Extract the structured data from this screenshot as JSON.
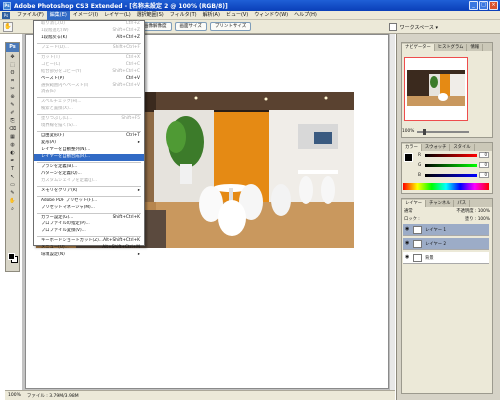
{
  "window": {
    "title": "Adobe Photoshop CS3 Extended - [名称未設定 2 @ 100% (RGB/8)]",
    "app_icon": "Ps",
    "minimize": "_",
    "maximize": "□",
    "close": "×"
  },
  "menubar": {
    "icon": "Ps",
    "items": [
      "ファイル(F)",
      "編集(E)",
      "イメージ(I)",
      "レイヤー(L)",
      "選択範囲(S)",
      "フィルタ(T)",
      "解析(A)",
      "ビュー(V)",
      "ウィンドウ(W)",
      "ヘルプ(H)"
    ]
  },
  "options_bar": {
    "tool_icon": "✋",
    "buttons": [
      "画像解像度",
      "画面サイズ",
      "プリントサイズ"
    ],
    "workspace_label": "ワークスペース ▾"
  },
  "edit_menu": {
    "items": [
      {
        "label": "取り消し(O)",
        "shortcut": "Ctrl+Z",
        "state": "disabled"
      },
      {
        "label": "1段階進む(W)",
        "shortcut": "Shift+Ctrl+Z",
        "state": "disabled"
      },
      {
        "label": "1段階戻る(K)",
        "shortcut": "Alt+Ctrl+Z",
        "state": "normal"
      },
      {
        "sep": true
      },
      {
        "label": "フェード(D)...",
        "shortcut": "Shift+Ctrl+F",
        "state": "disabled"
      },
      {
        "sep": true
      },
      {
        "label": "カット(T)",
        "shortcut": "Ctrl+X",
        "state": "disabled"
      },
      {
        "label": "コピー(C)",
        "shortcut": "Ctrl+C",
        "state": "disabled"
      },
      {
        "label": "結合部分をコピー(Y)",
        "shortcut": "Shift+Ctrl+C",
        "state": "disabled"
      },
      {
        "label": "ペースト(P)",
        "shortcut": "Ctrl+V",
        "state": "normal"
      },
      {
        "label": "選択範囲内へペースト(I)",
        "shortcut": "Shift+Ctrl+V",
        "state": "disabled"
      },
      {
        "label": "消去(E)",
        "shortcut": "",
        "state": "disabled"
      },
      {
        "sep": true
      },
      {
        "label": "スペルチェック(H)...",
        "shortcut": "",
        "state": "disabled"
      },
      {
        "label": "検索と置換(X)...",
        "shortcut": "",
        "state": "disabled"
      },
      {
        "sep": true
      },
      {
        "label": "塗りつぶし(L)...",
        "shortcut": "Shift+F5",
        "state": "disabled"
      },
      {
        "label": "境界線を描く(S)...",
        "shortcut": "",
        "state": "disabled"
      },
      {
        "sep": true
      },
      {
        "label": "自由変形(F)",
        "shortcut": "Ctrl+T",
        "state": "normal"
      },
      {
        "label": "変形(A)",
        "shortcut": "▸",
        "state": "normal"
      },
      {
        "label": "レイヤーを自動整列(N)...",
        "shortcut": "",
        "state": "normal"
      },
      {
        "label": "レイヤーを自動合成(R)...",
        "shortcut": "",
        "state": "highlight"
      },
      {
        "sep": true
      },
      {
        "label": "ブラシを定義(B)...",
        "shortcut": "",
        "state": "normal"
      },
      {
        "label": "パターンを定義(Q)...",
        "shortcut": "",
        "state": "normal"
      },
      {
        "label": "カスタムシェイプを定義(J)...",
        "shortcut": "",
        "state": "disabled"
      },
      {
        "sep": true
      },
      {
        "label": "メモリをクリア(R)",
        "shortcut": "▸",
        "state": "normal"
      },
      {
        "sep": true
      },
      {
        "label": "Adobe PDF プリセット(F)...",
        "shortcut": "",
        "state": "normal"
      },
      {
        "label": "プリセットマネージャ(M)...",
        "shortcut": "",
        "state": "normal"
      },
      {
        "sep": true
      },
      {
        "label": "カラー設定(G)...",
        "shortcut": "Shift+Ctrl+K",
        "state": "normal"
      },
      {
        "label": "プロファイルの指定(P)...",
        "shortcut": "",
        "state": "normal"
      },
      {
        "label": "プロファイル変換(V)...",
        "shortcut": "",
        "state": "normal"
      },
      {
        "sep": true
      },
      {
        "label": "キーボードショートカット(Z)...",
        "shortcut": "Alt+Shift+Ctrl+K",
        "state": "normal"
      },
      {
        "label": "メニュー(U)...",
        "shortcut": "Alt+Shift+Ctrl+M",
        "state": "normal"
      },
      {
        "label": "環境設定(N)",
        "shortcut": "▸",
        "state": "normal"
      }
    ]
  },
  "toolbox": {
    "logo": "Ps",
    "tools": [
      "✥",
      "⬚",
      "ʘ",
      "⌗",
      "✂",
      "⊕",
      "✎",
      "✐",
      "⎘",
      "⌫",
      "▦",
      "◍",
      "◐",
      "✒",
      "T",
      "↖",
      "▭",
      "✎",
      "✋",
      "⌕"
    ]
  },
  "status_bar": {
    "zoom": "100%",
    "file_info": "ファイル : 3.79M/3.98M"
  },
  "navigator_panel": {
    "tabs": [
      "ナビゲーター",
      "ヒストグラム",
      "情報"
    ],
    "zoom_value": "100%"
  },
  "color_panel": {
    "tabs": [
      "カラー",
      "スウォッチ",
      "スタイル"
    ],
    "channels": [
      {
        "label": "R",
        "value": "0",
        "color": "#ff0000"
      },
      {
        "label": "G",
        "value": "0",
        "color": "#00ff00"
      },
      {
        "label": "B",
        "value": "0",
        "color": "#0000ff"
      }
    ]
  },
  "layers_panel": {
    "tabs": [
      "レイヤー",
      "チャンネル",
      "パス"
    ],
    "blend_mode": "通常",
    "opacity_label": "不透明度 :",
    "opacity_value": "100%",
    "lock_label": "ロック :",
    "fill_label": "塗り :",
    "fill_value": "100%",
    "layers": [
      {
        "name": "レイヤー 1",
        "selected": true
      },
      {
        "name": "レイヤー 2",
        "selected": true
      },
      {
        "name": "背景",
        "selected": false
      }
    ]
  },
  "colors": {
    "title_blue": "#0a3fb8",
    "menu_highlight": "#316ac5",
    "xp_face": "#ece9d8",
    "canvas_gray": "#c2c2c2"
  }
}
